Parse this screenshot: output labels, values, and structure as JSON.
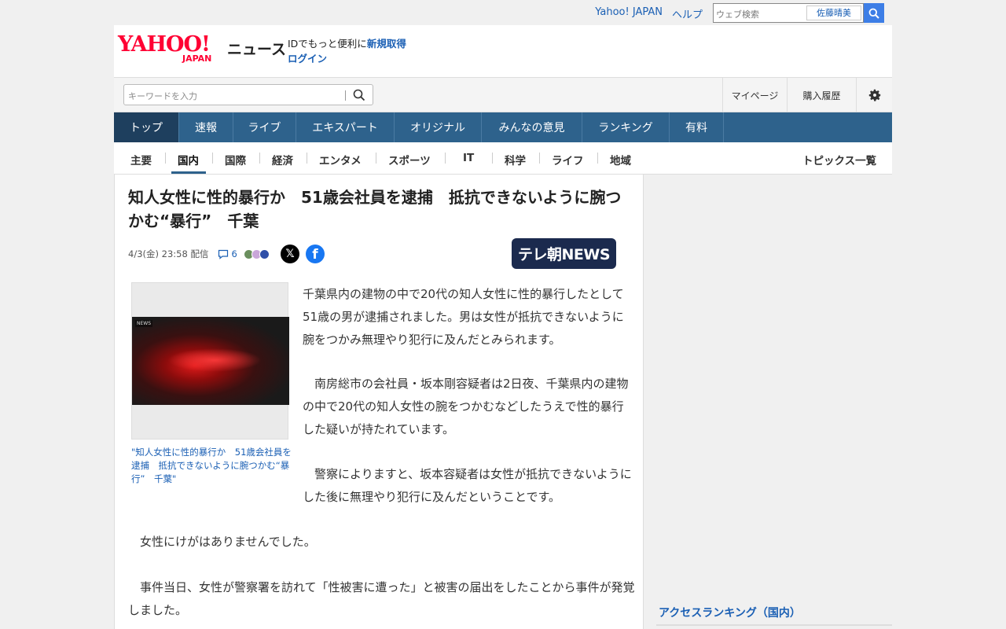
{
  "topbar": {
    "yahoo_japan": "Yahoo! JAPAN",
    "help": "ヘルプ",
    "web_search_placeholder": "ウェブ検索",
    "user_name": "佐藤晴美"
  },
  "header": {
    "logo_text": "YAHOO!",
    "logo_sub": "JAPAN",
    "service_name": "ニュース",
    "id_prompt": "IDでもっと便利に",
    "register": "新規取得",
    "login": "ログイン"
  },
  "searchbar": {
    "placeholder": "キーワードを入力",
    "my_page": "マイページ",
    "purchase_history": "購入履歴"
  },
  "main_nav": [
    "トップ",
    "速報",
    "ライブ",
    "エキスパート",
    "オリジナル",
    "みんなの意見",
    "ランキング",
    "有料"
  ],
  "sub_nav": [
    "主要",
    "国内",
    "国際",
    "経済",
    "エンタメ",
    "スポーツ",
    "IT",
    "科学",
    "ライフ",
    "地域"
  ],
  "sub_nav_active": "国内",
  "topics_list": "トピックス一覧",
  "article": {
    "title": "知人女性に性的暴行か　51歳会社員を逮捕　抵抗できないように腕つかむ“暴行”　千葉",
    "date": "4/3(金) 23:58",
    "distributed": "配信",
    "comment_count": "6",
    "source": "テレ朝NEWS",
    "photo_tag": "NEWS",
    "caption": "\"知人女性に性的暴行か　51歳会社員を逮捕　抵抗できないように腕つかむ“暴行”　千葉\"",
    "paragraphs": [
      "千葉県内の建物の中で20代の知人女性に性的暴行したとして51歳の男が逮捕されました。男は女性が抵抗できないように腕をつかみ無理やり犯行に及んだとみられます。",
      "　南房総市の会社員・坂本剛容疑者は2日夜、千葉県内の建物の中で20代の知人女性の腕をつかむなどしたうえで性的暴行した疑いが持たれています。",
      "　警察によりますと、坂本容疑者は女性が抵抗できないようにした後に無理やり犯行に及んだということです。",
      "　女性にけがはありませんでした。",
      "　事件当日、女性が警察署を訪れて「性被害に遭った」と被害の届出をしたことから事件が発覚しました。"
    ]
  },
  "sidebar": {
    "access_ranking": "アクセスランキング（国内）"
  },
  "colors": {
    "brand_red": "#ff0033",
    "nav_blue": "#2e628c",
    "link_blue": "#1a5fb4"
  }
}
